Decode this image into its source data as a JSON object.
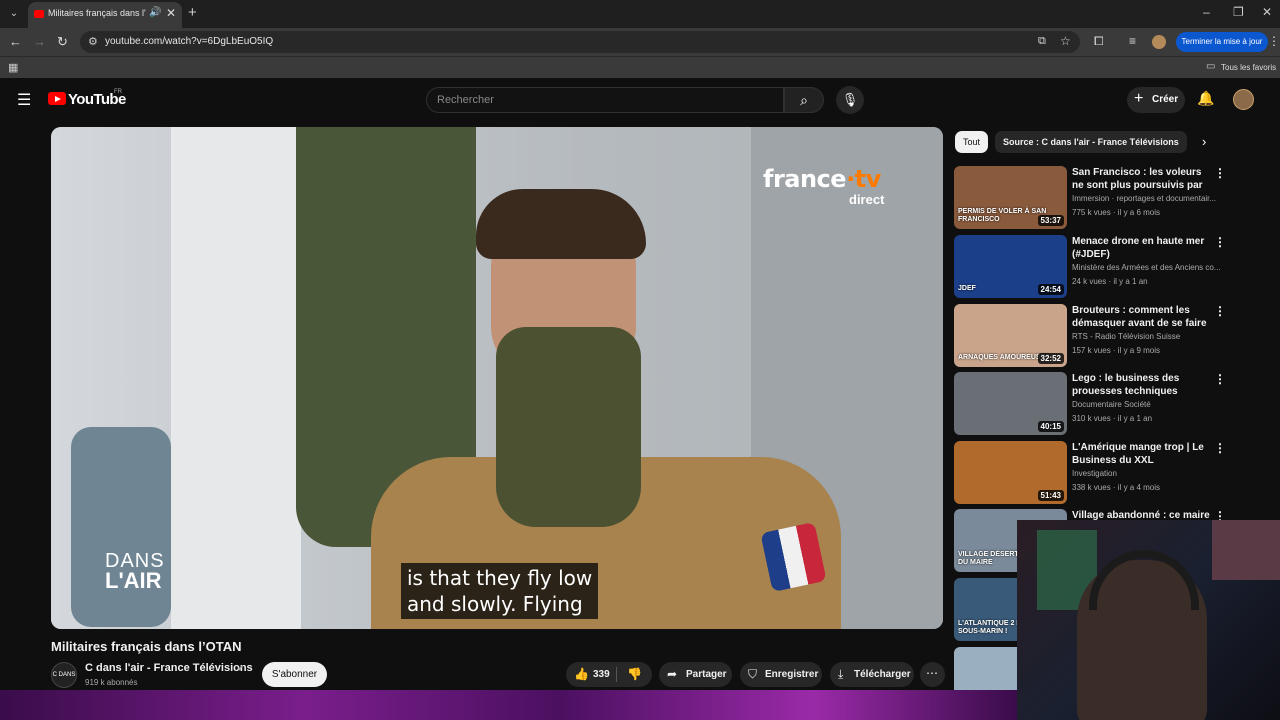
{
  "browser": {
    "tab_title": "Militaires français dans l'OTAN",
    "url": "youtube.com/watch?v=6DgLbEuO5IQ",
    "update_button": "Terminer la mise à jour",
    "bookmarks_label": "Tous les favoris"
  },
  "masthead": {
    "logo_text": "YouTube",
    "country": "FR",
    "search_placeholder": "Rechercher",
    "create_label": "Créer"
  },
  "player": {
    "brand_logo": "france",
    "brand_logo_accent": "·tv",
    "brand_sub": "direct",
    "show_logo_top": "DANS",
    "show_logo_bottom": "L'AIR",
    "subtitle_line1": "is that they fly low",
    "subtitle_line2": "and slowly.  Flying"
  },
  "video": {
    "title": "Militaires français dans l’OTAN",
    "channel_name": "C dans l'air - France Télévisions",
    "channel_avatar_text": "C DANS L'AIR",
    "subscribers": "919 k abonnés",
    "subscribe_label": "S'abonner",
    "likes": "339",
    "share_label": "Partager",
    "save_label": "Enregistrer",
    "download_label": "Télécharger"
  },
  "chips": {
    "all": "Tout",
    "source": "Source : C dans l'air - France Télévisions"
  },
  "recommendations": [
    {
      "title": "San Francisco : les voleurs ne sont plus poursuivis par la ...",
      "channel": "Immersion · reportages et documentair...",
      "meta": "775 k vues · il y a 6 mois",
      "duration": "53:37",
      "overlay": "PERMIS DE VOLER À SAN FRANCISCO",
      "color": "#8a5a3c"
    },
    {
      "title": "Menace drone en haute mer (#JDEF)",
      "channel": "Ministère des Armées et des Anciens co...",
      "meta": "24 k vues · il y a 1 an",
      "duration": "24:54",
      "overlay": "JDEF",
      "color": "#1c3f8a"
    },
    {
      "title": "Brouteurs : comment les démasquer avant de se faire ...",
      "channel": "RTS - Radio Télévision Suisse",
      "meta": "157 k vues · il y a 9 mois",
      "duration": "32:52",
      "overlay": "ARNAQUES AMOUREUSES",
      "color": "#c9a48a"
    },
    {
      "title": "Lego : le business des prouesses techniques",
      "channel": "Documentaire Société",
      "meta": "310 k vues · il y a 1 an",
      "duration": "40:15",
      "overlay": "",
      "color": "#6a6f75"
    },
    {
      "title": "L'Amérique mange trop | Le Business du XXL",
      "channel": "Investigation",
      "meta": "338 k vues · il y a 4 mois",
      "duration": "51:43",
      "overlay": "",
      "color": "#b06a2c"
    },
    {
      "title": "Village abandonné : ce maire se",
      "channel": "",
      "meta": "",
      "duration": "",
      "overlay": "VILLAGE DÉSERT LE COMBAT DU MAIRE",
      "color": "#7a8a9a"
    },
    {
      "title": "",
      "channel": "",
      "meta": "",
      "duration": "",
      "overlay": "L'ATLANTIQUE 2 FACE AU SOUS-MARIN !",
      "color": "#3a5a7a"
    },
    {
      "title": "",
      "channel": "",
      "meta": "",
      "duration": "",
      "overlay": "",
      "color": "#9ab0c0"
    }
  ],
  "colors": {
    "yt_red": "#ff0000",
    "update_blue": "#0b57d0",
    "background": "#0f0f0f"
  }
}
